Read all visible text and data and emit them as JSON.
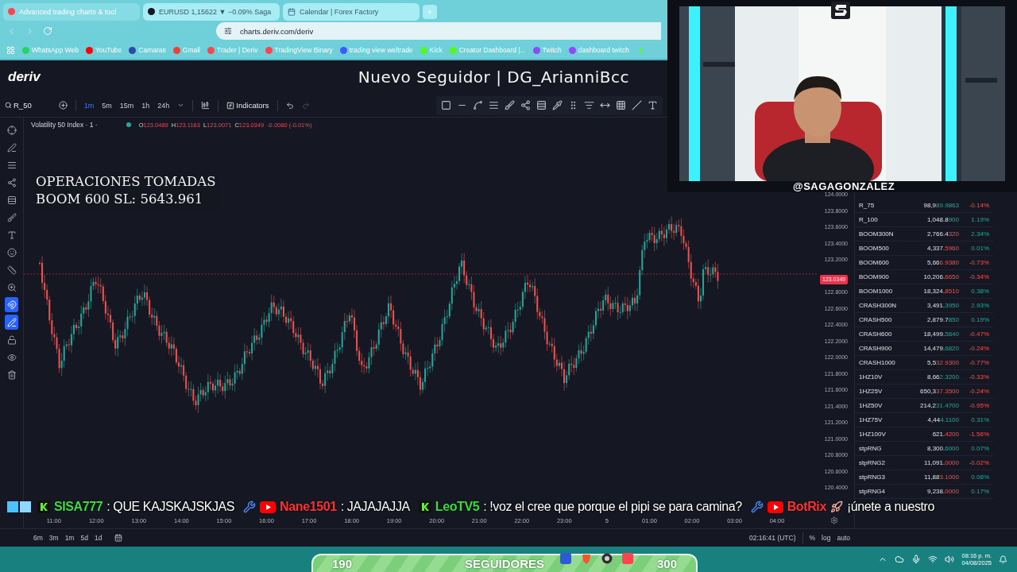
{
  "browser": {
    "tabs": [
      {
        "title": "Advanced trading charts & tool",
        "selected": true
      },
      {
        "title": "EURUSD 1,15622 ▼ −0.09% Saga",
        "selected": false
      },
      {
        "title": "Calendar | Forex Factory",
        "selected": false
      }
    ],
    "address": "charts.deriv.com/deriv",
    "bookmarks": [
      {
        "label": "WhatsApp Web",
        "color": "#25d366"
      },
      {
        "label": "YouTube",
        "color": "#ff0000"
      },
      {
        "label": "Camaras",
        "color": "#2c4aa8"
      },
      {
        "label": "Gmail",
        "color": "#ea4335"
      },
      {
        "label": "Trader | Deriv",
        "color": "#ff444f"
      },
      {
        "label": "TradingView Binary",
        "color": "#ff444f"
      },
      {
        "label": "trading view weltrade",
        "color": "#3d5afe"
      },
      {
        "label": "Kick",
        "color": "#53fc18"
      },
      {
        "label": "Creator Dashboard |...",
        "color": "#53fc18"
      },
      {
        "label": "Twitch",
        "color": "#9146ff"
      },
      {
        "label": "dashboard twitch",
        "color": "#9146ff"
      }
    ]
  },
  "header": {
    "logo": "deriv",
    "follower_alert": "Nuevo Seguidor | DG_ArianniBcc"
  },
  "toolbar": {
    "symbol": "R_50",
    "intervals": [
      {
        "label": "1m",
        "selected": true
      },
      {
        "label": "5m",
        "selected": false
      },
      {
        "label": "15m",
        "selected": false
      },
      {
        "label": "1h",
        "selected": false
      },
      {
        "label": "24h",
        "selected": false
      }
    ],
    "indicators": "Indicators"
  },
  "tools": [
    {
      "kind": "crosshair",
      "on": false
    },
    {
      "kind": "line",
      "on": false
    },
    {
      "kind": "lines",
      "on": false
    },
    {
      "kind": "pattern",
      "on": false
    },
    {
      "kind": "fib",
      "on": false
    },
    {
      "kind": "brush",
      "on": false
    },
    {
      "kind": "text",
      "on": false
    },
    {
      "kind": "emoji",
      "on": false
    },
    {
      "kind": "ruler",
      "on": false
    },
    {
      "kind": "zoom",
      "on": false
    },
    {
      "kind": "magnet",
      "on": true
    },
    {
      "kind": "draw-lock",
      "on": true
    },
    {
      "kind": "lock",
      "on": false
    },
    {
      "kind": "eye",
      "on": false
    },
    {
      "kind": "trash",
      "on": false
    }
  ],
  "chart": {
    "legend": "Volatility 50 Index · 1 ·",
    "market_open": true,
    "ohlc": [
      {
        "label": "O",
        "value": "123.0489"
      },
      {
        "label": "H",
        "value": "123.1163"
      },
      {
        "label": "L",
        "value": "123.0071"
      },
      {
        "label": "C",
        "value": "123.0349"
      }
    ],
    "change": "-0.0080 (-0.01%)",
    "overlay_lines": [
      "OPERACIONES TOMADAS",
      "BOOM 600 SL: 5643.961"
    ],
    "price_ticks": [
      "124.0000",
      "123.8000",
      "123.6000",
      "123.4000",
      "123.2000",
      "122.8000",
      "122.6000",
      "122.4000",
      "122.2000",
      "122.0000",
      "121.8000",
      "121.6000",
      "121.4000",
      "121.2000",
      "121.0000",
      "120.8000",
      "120.6000",
      "120.4000"
    ],
    "current_price": "123.0349",
    "time_labels": [
      "11:00",
      "12:00",
      "13:00",
      "14:00",
      "15:00",
      "16:00",
      "17:00",
      "18:00",
      "19:00",
      "20:00",
      "21:00",
      "22:00",
      "23:00",
      "5",
      "01:00",
      "02:00",
      "03:00",
      "04:00"
    ]
  },
  "watchlist": [
    {
      "symbol": "R_75",
      "price": "98,9",
      "tail": "89.9863",
      "tail_rising": true,
      "change": "-0.14%",
      "rising": false
    },
    {
      "symbol": "R_100",
      "price": "1,048.8",
      "tail": "900",
      "tail_rising": true,
      "change": "1.19%",
      "rising": true
    },
    {
      "symbol": "BOOM300N",
      "price": "2,766.4",
      "tail": "320",
      "tail_rising": false,
      "change": "2.34%",
      "rising": true
    },
    {
      "symbol": "BOOM500",
      "price": "4,337.",
      "tail": "5960",
      "tail_rising": false,
      "change": "0.01%",
      "rising": true
    },
    {
      "symbol": "BOOM600",
      "price": "5,66",
      "tail": "6.9380",
      "tail_rising": false,
      "change": "-0.73%",
      "rising": false
    },
    {
      "symbol": "BOOM900",
      "price": "10,206.",
      "tail": "6650",
      "tail_rising": false,
      "change": "-0.34%",
      "rising": false
    },
    {
      "symbol": "BOOM1000",
      "price": "18,324.",
      "tail": "8510",
      "tail_rising": false,
      "change": "0.38%",
      "rising": true
    },
    {
      "symbol": "CRASH300N",
      "price": "3,491.",
      "tail": "3950",
      "tail_rising": true,
      "change": "2.93%",
      "rising": true
    },
    {
      "symbol": "CRASH500",
      "price": "2,879.7",
      "tail": "850",
      "tail_rising": true,
      "change": "0.19%",
      "rising": true
    },
    {
      "symbol": "CRASH600",
      "price": "18,499.",
      "tail": "5840",
      "tail_rising": true,
      "change": "-0.47%",
      "rising": false
    },
    {
      "symbol": "CRASH900",
      "price": "14,479.",
      "tail": "6820",
      "tail_rising": true,
      "change": "-0.24%",
      "rising": false
    },
    {
      "symbol": "CRASH1000",
      "price": "5,5",
      "tail": "32.9300",
      "tail_rising": false,
      "change": "-0.77%",
      "rising": false
    },
    {
      "symbol": "1HZ10V",
      "price": "8,66",
      "tail": "2.3200",
      "tail_rising": true,
      "change": "-0.33%",
      "rising": false
    },
    {
      "symbol": "1HZ25V",
      "price": "650,3",
      "tail": "37.3500",
      "tail_rising": false,
      "change": "-0.24%",
      "rising": false
    },
    {
      "symbol": "1HZ50V",
      "price": "214,2",
      "tail": "31.4700",
      "tail_rising": true,
      "change": "-0.95%",
      "rising": false
    },
    {
      "symbol": "1HZ75V",
      "price": "4,44",
      "tail": "4.1100",
      "tail_rising": true,
      "change": "0.31%",
      "rising": true
    },
    {
      "symbol": "1HZ100V",
      "price": "621.",
      "tail": "4200",
      "tail_rising": false,
      "change": "-1.56%",
      "rising": false
    },
    {
      "symbol": "stpRNG",
      "price": "8,300.",
      "tail": "6000",
      "tail_rising": true,
      "change": "0.07%",
      "rising": true
    },
    {
      "symbol": "stpRNG2",
      "price": "11,091.",
      "tail": "0000",
      "tail_rising": false,
      "change": "-0.02%",
      "rising": false
    },
    {
      "symbol": "stpRNG3",
      "price": "11,88",
      "tail": "3.1000",
      "tail_rising": false,
      "change": "0.08%",
      "rising": true
    },
    {
      "symbol": "stpRNG4",
      "price": "9,238.",
      "tail": "0000",
      "tail_rising": false,
      "change": "0.17%",
      "rising": true
    }
  ],
  "bottom_bar": {
    "ranges": [
      "6m",
      "3m",
      "1m",
      "5d",
      "1d"
    ],
    "clock": "02:16:41 (UTC)",
    "scale_options": [
      "%",
      "log",
      "auto"
    ]
  },
  "chat": [
    {
      "kind": "kick",
      "moderator": false,
      "user": "SISA777",
      "color": "#3ddc3d",
      "text": ": QUE KAJSKAJSKJAS",
      "rocket": false
    },
    {
      "kind": "youtube",
      "moderator": true,
      "user": "Nane1501",
      "color": "#ff3030",
      "text": ": JAJAJAJJA",
      "rocket": false
    },
    {
      "kind": "kick",
      "moderator": false,
      "user": "LeoTV5",
      "color": "#3ddc3d",
      "text": ": !voz el cree que porque el pipi se para camina?",
      "rocket": false
    },
    {
      "kind": "youtube",
      "moderator": true,
      "user": "BotRix",
      "color": "#ff3030",
      "text": "¡únete a nuestro",
      "rocket": true
    }
  ],
  "webcam": {
    "handle": "@SAGAGONZALEZ"
  },
  "goal": {
    "current": "190",
    "label": "SEGUIDORES",
    "target": "300"
  },
  "taskbar": {
    "time": "08:16 p. m.",
    "date": "04/08/2025"
  }
}
